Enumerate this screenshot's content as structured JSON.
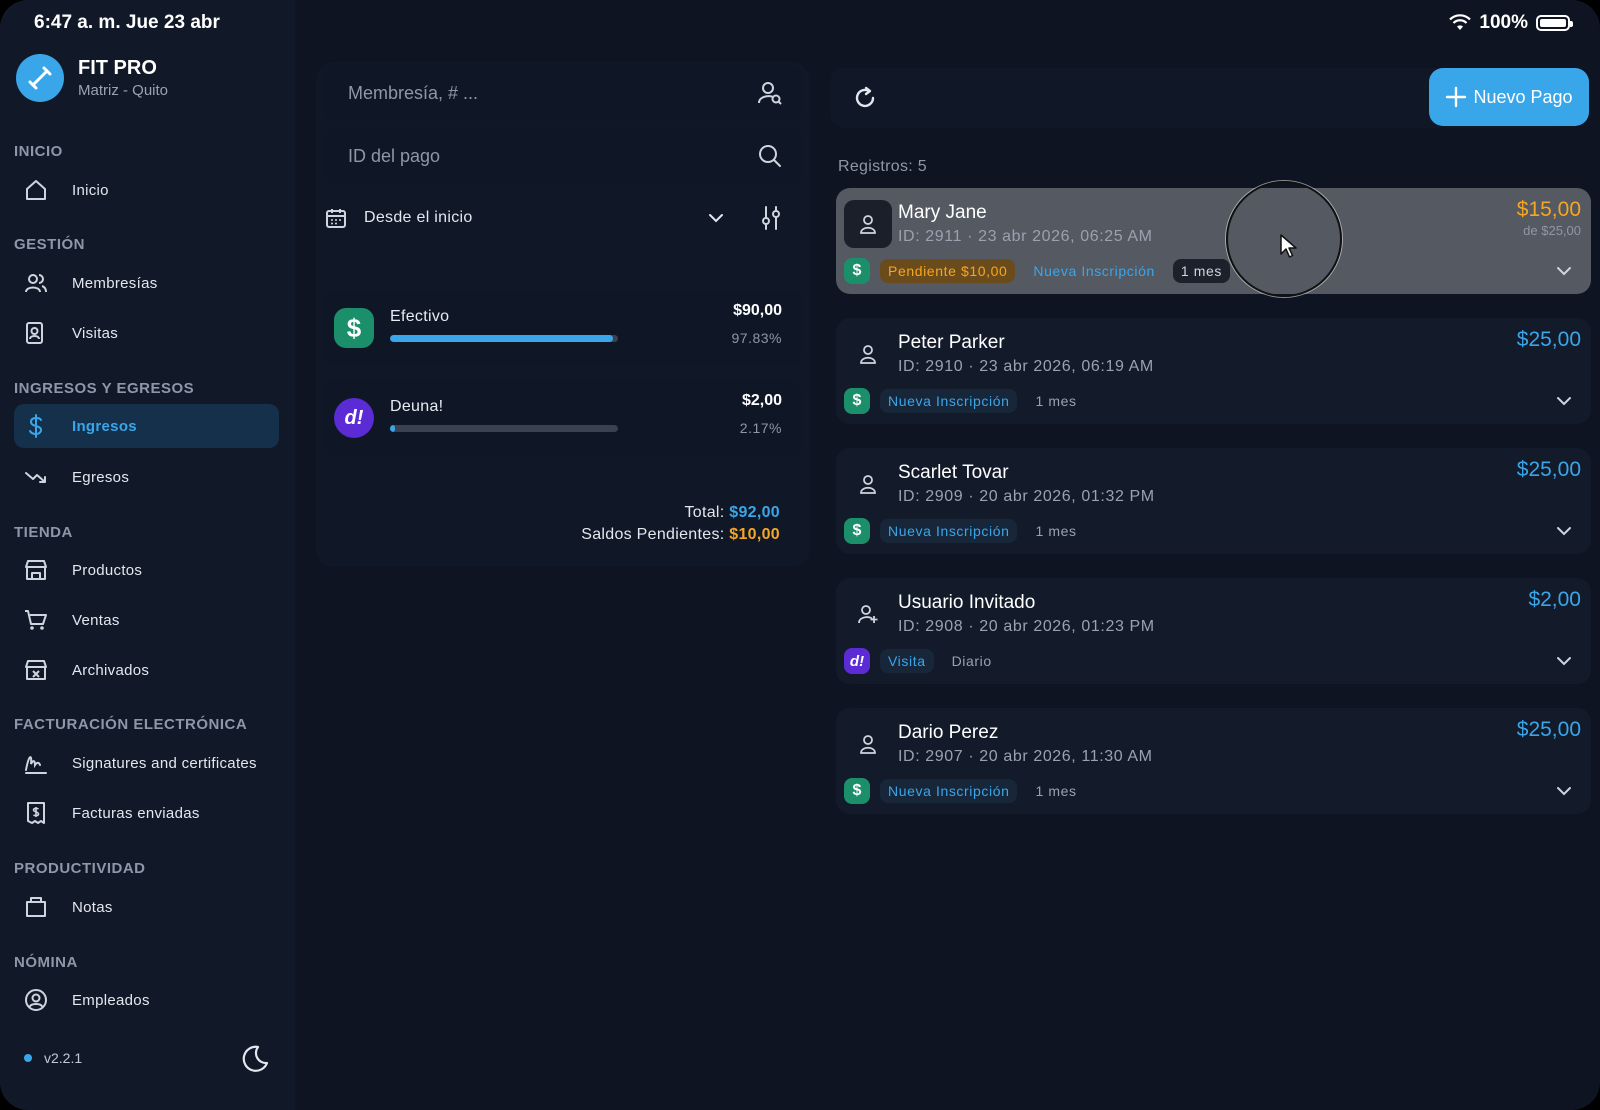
{
  "status_bar": {
    "time": "6:47 a. m.  Jue 23 abr",
    "battery": "100%"
  },
  "brand": {
    "name": "FIT PRO",
    "branch": "Matriz - Quito"
  },
  "sidebar": {
    "sections": [
      {
        "title": "INICIO"
      },
      {
        "title": "GESTIÓN"
      },
      {
        "title": "INGRESOS Y EGRESOS"
      },
      {
        "title": "TIENDA"
      },
      {
        "title": "FACTURACIÓN ELECTRÓNICA"
      },
      {
        "title": "PRODUCTIVIDAD"
      },
      {
        "title": "NÓMINA"
      }
    ],
    "items": [
      {
        "label": "Inicio",
        "icon": "home-icon"
      },
      {
        "label": "Membresías",
        "icon": "users-icon"
      },
      {
        "label": "Visitas",
        "icon": "visits-icon"
      },
      {
        "label": "Ingresos",
        "icon": "dollar-icon"
      },
      {
        "label": "Egresos",
        "icon": "trend-down-icon"
      },
      {
        "label": "Productos",
        "icon": "store-icon"
      },
      {
        "label": "Ventas",
        "icon": "cart-icon"
      },
      {
        "label": "Archivados",
        "icon": "archive-icon"
      },
      {
        "label": "Signatures and certificates",
        "icon": "signature-icon"
      },
      {
        "label": "Facturas enviadas",
        "icon": "receipt-icon"
      },
      {
        "label": "Notas",
        "icon": "notes-icon"
      },
      {
        "label": "Empleados",
        "icon": "employee-icon"
      }
    ],
    "version": "v2.2.1"
  },
  "filters": {
    "membership_placeholder": "Membresía, # ...",
    "payment_id_placeholder": "ID del pago",
    "date_range": "Desde el inicio"
  },
  "payment_methods": [
    {
      "name": "Efectivo",
      "amount": "$90,00",
      "percent": "97.83%",
      "share": 0.9783,
      "icon": "$"
    },
    {
      "name": "Deuna!",
      "amount": "$2,00",
      "percent": "2.17%",
      "share": 0.0217,
      "icon": "d!"
    }
  ],
  "totals": {
    "total_label": "Total:",
    "total_value": "$92,00",
    "pending_label": "Saldos Pendientes:",
    "pending_value": "$10,00"
  },
  "actions": {
    "new_payment": "Nuevo Pago"
  },
  "records_label": "Registros: 5",
  "payments": [
    {
      "name": "Mary Jane",
      "meta": "ID: 2911  ·  23 abr 2026, 06:25 AM",
      "amount": "$15,00",
      "sub": "de $25,00",
      "pending": "Pendiente $10,00",
      "type": "Nueva Inscripción",
      "period": "1 mes",
      "method": "cash"
    },
    {
      "name": "Peter Parker",
      "meta": "ID: 2910  ·  23 abr 2026, 06:19 AM",
      "amount": "$25,00",
      "type": "Nueva Inscripción",
      "period": "1 mes",
      "method": "cash"
    },
    {
      "name": "Scarlet Tovar",
      "meta": "ID: 2909  ·  20 abr 2026, 01:32 PM",
      "amount": "$25,00",
      "type": "Nueva Inscripción",
      "period": "1 mes",
      "method": "cash"
    },
    {
      "name": "Usuario Invitado",
      "meta": "ID: 2908  ·  20 abr 2026, 01:23 PM",
      "amount": "$2,00",
      "type": "Visita",
      "period": "Diario",
      "method": "deuna"
    },
    {
      "name": "Dario Perez",
      "meta": "ID: 2907  ·  20 abr 2026, 11:30 AM",
      "amount": "$25,00",
      "type": "Nueva Inscripción",
      "period": "1 mes",
      "method": "cash"
    }
  ],
  "colors": {
    "accent": "#3aa6ea",
    "warning": "#f5a623",
    "cash": "#1b8f6a",
    "deuna": "#5b2bd6"
  }
}
